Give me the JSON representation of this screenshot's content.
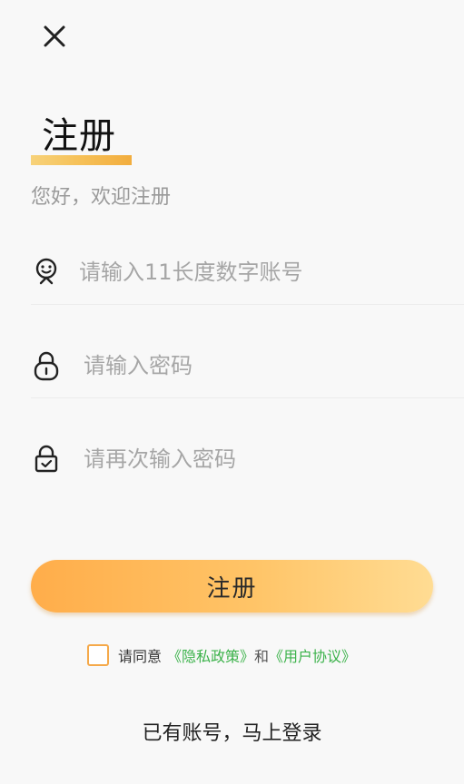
{
  "header": {
    "close_icon": "close-icon"
  },
  "page": {
    "title": "注册",
    "subtitle": "您好，欢迎注册",
    "accent_color": "#f6b94a"
  },
  "form": {
    "phone": {
      "icon": "user-face-icon",
      "placeholder": "请输入11长度数字账号",
      "value": ""
    },
    "password": {
      "icon": "lock-icon",
      "placeholder": "请输入密码",
      "value": ""
    },
    "confirm_password": {
      "icon": "lock-check-icon",
      "placeholder": "请再次输入密码",
      "value": ""
    },
    "submit_label": "注册"
  },
  "agreement": {
    "checked": false,
    "prefix": "请同意",
    "privacy_link": "《隐私政策》",
    "and": "和",
    "user_agreement_link": "《用户协议》",
    "link_color": "#3bb24a"
  },
  "footer": {
    "login_prompt": "已有账号，马上登录"
  }
}
